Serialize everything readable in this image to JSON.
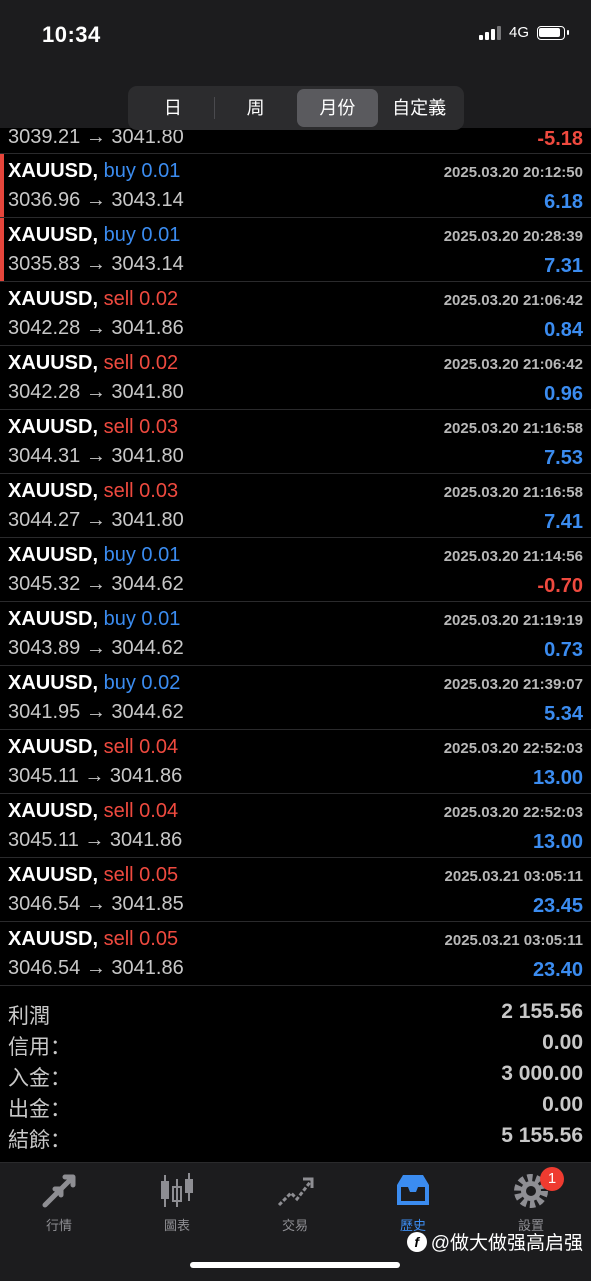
{
  "status": {
    "time": "10:34",
    "network": "4G",
    "battery_level": 0.9
  },
  "segments": {
    "items": [
      "日",
      "周",
      "月份",
      "自定義"
    ],
    "active_index": 2
  },
  "partial_row": {
    "price": "3039.21 → 3041.80",
    "pnl": "-5.18"
  },
  "trades": [
    {
      "symbol": "XAUUSD,",
      "side": "buy",
      "volume": "0.01",
      "time": "2025.03.20 20:12:50",
      "price": "3036.96 → 3043.14",
      "pnl": "6.18"
    },
    {
      "symbol": "XAUUSD,",
      "side": "buy",
      "volume": "0.01",
      "time": "2025.03.20 20:28:39",
      "price": "3035.83 → 3043.14",
      "pnl": "7.31"
    },
    {
      "symbol": "XAUUSD,",
      "side": "sell",
      "volume": "0.02",
      "time": "2025.03.20 21:06:42",
      "price": "3042.28 → 3041.86",
      "pnl": "0.84"
    },
    {
      "symbol": "XAUUSD,",
      "side": "sell",
      "volume": "0.02",
      "time": "2025.03.20 21:06:42",
      "price": "3042.28 → 3041.80",
      "pnl": "0.96"
    },
    {
      "symbol": "XAUUSD,",
      "side": "sell",
      "volume": "0.03",
      "time": "2025.03.20 21:16:58",
      "price": "3044.31 → 3041.80",
      "pnl": "7.53"
    },
    {
      "symbol": "XAUUSD,",
      "side": "sell",
      "volume": "0.03",
      "time": "2025.03.20 21:16:58",
      "price": "3044.27 → 3041.80",
      "pnl": "7.41"
    },
    {
      "symbol": "XAUUSD,",
      "side": "buy",
      "volume": "0.01",
      "time": "2025.03.20 21:14:56",
      "price": "3045.32 → 3044.62",
      "pnl": "-0.70"
    },
    {
      "symbol": "XAUUSD,",
      "side": "buy",
      "volume": "0.01",
      "time": "2025.03.20 21:19:19",
      "price": "3043.89 → 3044.62",
      "pnl": "0.73"
    },
    {
      "symbol": "XAUUSD,",
      "side": "buy",
      "volume": "0.02",
      "time": "2025.03.20 21:39:07",
      "price": "3041.95 → 3044.62",
      "pnl": "5.34"
    },
    {
      "symbol": "XAUUSD,",
      "side": "sell",
      "volume": "0.04",
      "time": "2025.03.20 22:52:03",
      "price": "3045.11 → 3041.86",
      "pnl": "13.00"
    },
    {
      "symbol": "XAUUSD,",
      "side": "sell",
      "volume": "0.04",
      "time": "2025.03.20 22:52:03",
      "price": "3045.11 → 3041.86",
      "pnl": "13.00"
    },
    {
      "symbol": "XAUUSD,",
      "side": "sell",
      "volume": "0.05",
      "time": "2025.03.21 03:05:11",
      "price": "3046.54 → 3041.85",
      "pnl": "23.45"
    },
    {
      "symbol": "XAUUSD,",
      "side": "sell",
      "volume": "0.05",
      "time": "2025.03.21 03:05:11",
      "price": "3046.54 → 3041.86",
      "pnl": "23.40"
    }
  ],
  "summary": [
    {
      "label": "利潤",
      "value": "2 155.56"
    },
    {
      "label": "信用：",
      "value": "0.00"
    },
    {
      "label": "入金：",
      "value": "3 000.00"
    },
    {
      "label": "出金：",
      "value": "0.00"
    },
    {
      "label": "結餘：",
      "value": "5 155.56"
    }
  ],
  "tabs": [
    {
      "label": "行情",
      "icon": "quotes-arrows-icon"
    },
    {
      "label": "圖表",
      "icon": "candlestick-chart-icon"
    },
    {
      "label": "交易",
      "icon": "trade-trend-icon"
    },
    {
      "label": "歷史",
      "icon": "history-inbox-icon"
    },
    {
      "label": "設置",
      "icon": "settings-gear-icon"
    }
  ],
  "active_tab": 3,
  "settings_badge": "1",
  "watermark": {
    "logo_letter": "f",
    "text": "@做大做强高启强"
  },
  "colors": {
    "buy": "#3b8cf0",
    "sell": "#ef4a3f",
    "profit": "#3b8cf0",
    "loss": "#ef4a3f",
    "active_tab": "#3b8cf0",
    "badge": "#ef3b30"
  }
}
